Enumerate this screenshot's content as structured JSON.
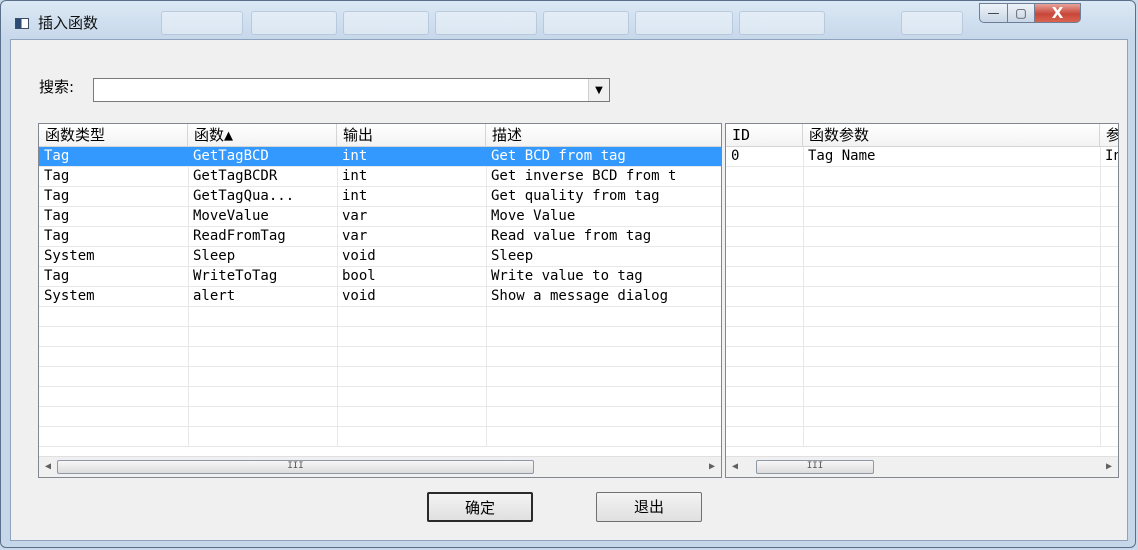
{
  "window": {
    "title": "插入函数",
    "minimize_glyph": "—",
    "maximize_glyph": "▢",
    "close_glyph": "X"
  },
  "search": {
    "label": "搜索:",
    "value": "",
    "dropdown_glyph": "▼"
  },
  "functions_table": {
    "columns": [
      "函数类型",
      "函数▲",
      "输出",
      "描述"
    ],
    "rows": [
      {
        "type": "Tag",
        "name": "GetTagBCD",
        "output": "int",
        "desc": "Get BCD from tag",
        "selected": true
      },
      {
        "type": "Tag",
        "name": "GetTagBCDR",
        "output": "int",
        "desc": "Get inverse BCD from t"
      },
      {
        "type": "Tag",
        "name": "GetTagQua...",
        "output": "int",
        "desc": "Get quality from tag"
      },
      {
        "type": "Tag",
        "name": "MoveValue",
        "output": "var",
        "desc": "Move Value"
      },
      {
        "type": "Tag",
        "name": "ReadFromTag",
        "output": "var",
        "desc": "Read value from tag"
      },
      {
        "type": "System",
        "name": "Sleep",
        "output": "void",
        "desc": "Sleep"
      },
      {
        "type": "Tag",
        "name": "WriteToTag",
        "output": "bool",
        "desc": "Write value to tag"
      },
      {
        "type": "System",
        "name": "alert",
        "output": "void",
        "desc": "Show a message dialog"
      }
    ],
    "scroll_left_glyph": "◀",
    "scroll_right_glyph": "▶",
    "thumb_grip": "III"
  },
  "params_table": {
    "columns": [
      "ID",
      "函数参数",
      "参"
    ],
    "rows": [
      {
        "id": "0",
        "param": "Tag Name",
        "extra": "In"
      }
    ],
    "scroll_left_glyph": "◀",
    "scroll_right_glyph": "▶",
    "thumb_grip": "III"
  },
  "buttons": {
    "ok": "确定",
    "exit": "退出"
  },
  "colors": {
    "selection": "#3399ff",
    "close_button": "#c8473a"
  }
}
